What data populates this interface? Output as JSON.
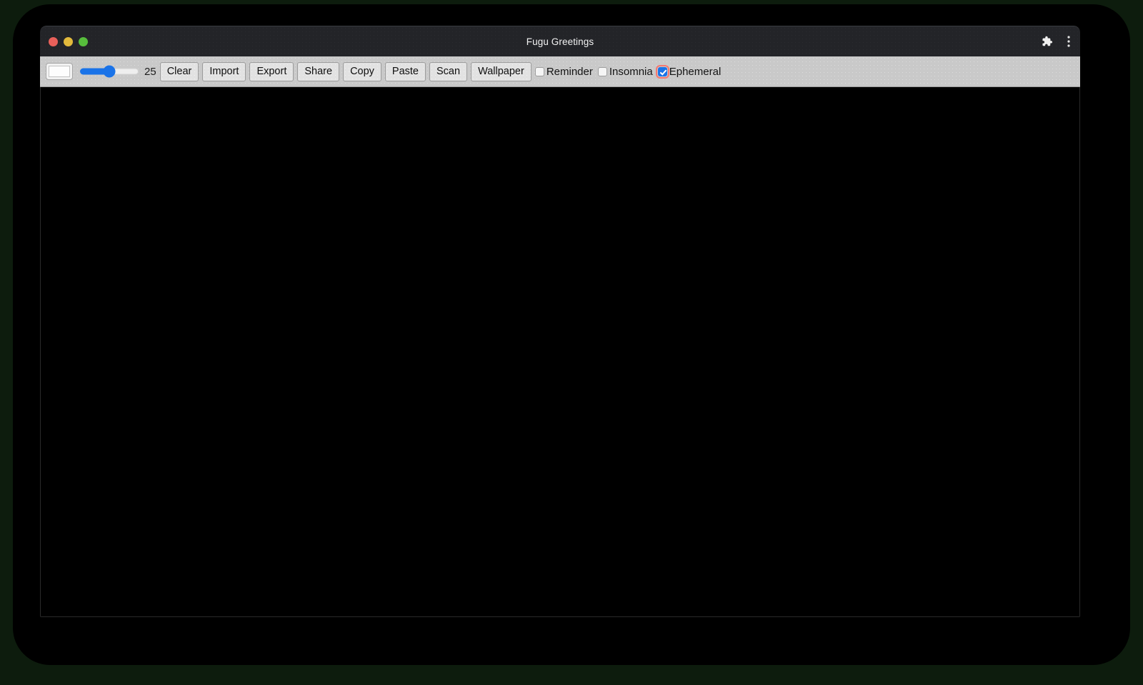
{
  "window": {
    "title": "Fugu Greetings",
    "traffic_lights": [
      {
        "name": "close",
        "color": "#e8605a"
      },
      {
        "name": "minimize",
        "color": "#e3ba3c"
      },
      {
        "name": "maximize",
        "color": "#57bd3c"
      }
    ],
    "actions": [
      {
        "name": "extensions-icon",
        "label": "Extensions"
      },
      {
        "name": "more-menu-icon",
        "label": "More"
      }
    ]
  },
  "toolbar": {
    "color_input": {
      "label": "Color",
      "value": "#fdfdfd"
    },
    "slider": {
      "label": "Line width",
      "value": "25",
      "min": "1",
      "max": "50",
      "percent": 50
    },
    "buttons": [
      {
        "name": "clear-button",
        "label": "Clear"
      },
      {
        "name": "import-button",
        "label": "Import"
      },
      {
        "name": "export-button",
        "label": "Export"
      },
      {
        "name": "share-button",
        "label": "Share"
      },
      {
        "name": "copy-button",
        "label": "Copy"
      },
      {
        "name": "paste-button",
        "label": "Paste"
      },
      {
        "name": "scan-button",
        "label": "Scan"
      },
      {
        "name": "wallpaper-button",
        "label": "Wallpaper"
      }
    ],
    "checkboxes": [
      {
        "name": "reminder-checkbox",
        "label": "Reminder",
        "checked": false,
        "focused": false
      },
      {
        "name": "insomnia-checkbox",
        "label": "Insomnia",
        "checked": false,
        "focused": false
      },
      {
        "name": "ephemeral-checkbox",
        "label": "Ephemeral",
        "checked": true,
        "focused": true
      }
    ]
  },
  "canvas": {
    "name": "drawing-canvas",
    "background": "#000000",
    "content": ""
  },
  "colors": {
    "page_background": "#0d1c0d",
    "backdrop": "#000000",
    "titlebar": "#232428",
    "toolbar": "#c9c9c9",
    "accent": "#1a73e8",
    "focus_ring": "#f4776f"
  }
}
